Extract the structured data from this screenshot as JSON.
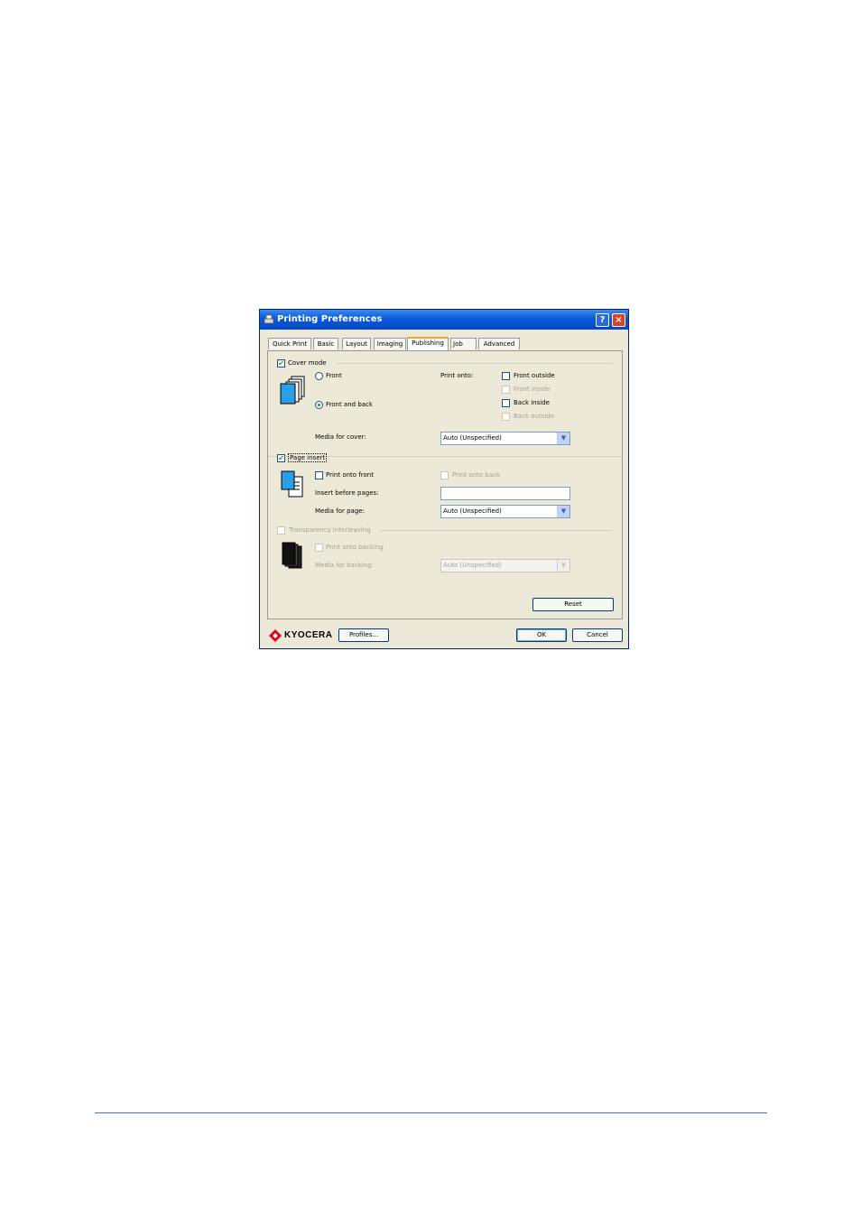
{
  "window": {
    "title": "Printing Preferences",
    "help_label": "?",
    "close_label": "×"
  },
  "tabs": [
    {
      "label": "Quick Print"
    },
    {
      "label": "Basic"
    },
    {
      "label": "Layout"
    },
    {
      "label": "Imaging"
    },
    {
      "label": "Publishing",
      "active": true
    },
    {
      "label": "Job"
    },
    {
      "label": "Advanced"
    }
  ],
  "cover_mode": {
    "label": "Cover mode",
    "checked": true,
    "front_label": "Front",
    "front_and_back_label": "Front and back",
    "selected": "Front and back",
    "print_onto_label": "Print onto:",
    "front_outside_label": "Front outside",
    "front_inside_label": "Front inside",
    "back_inside_label": "Back inside",
    "back_outside_label": "Back outside",
    "media_label": "Media for cover:",
    "media_value": "Auto (Unspecified)"
  },
  "page_insert": {
    "label": "Page insert",
    "checked": true,
    "print_onto_front_label": "Print onto front",
    "print_onto_back_label": "Print onto back",
    "insert_before_label": "Insert before pages:",
    "insert_before_value": "",
    "media_label": "Media for page:",
    "media_value": "Auto (Unspecified)"
  },
  "transparency": {
    "label": "Transparency interleaving",
    "checked": false,
    "print_onto_backing_label": "Print onto backing",
    "media_label": "Media for backing:",
    "media_value": "Auto (Unspecified)"
  },
  "reset_label": "Reset",
  "footer": {
    "brand": "KYOCERA",
    "profiles_label": "Profiles...",
    "ok_label": "OK",
    "cancel_label": "Cancel"
  },
  "colors": {
    "title_bar": "#0a5ad8",
    "dialog_bg": "#ece9d8",
    "check": "#21a121",
    "brand": "#e60012"
  }
}
